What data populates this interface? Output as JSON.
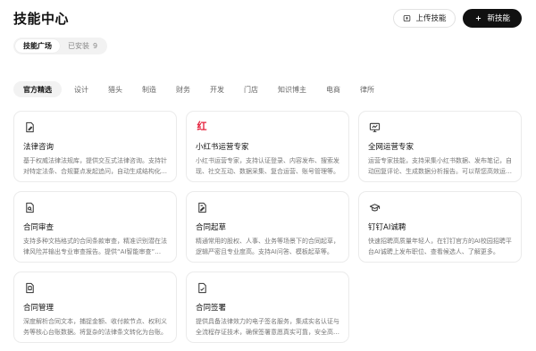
{
  "header": {
    "title": "技能中心",
    "upload_label": "上传技能",
    "new_label": "新技能"
  },
  "view_tabs": [
    {
      "label": "技能广场",
      "active": true
    },
    {
      "label": "已安装",
      "count": "9",
      "active": false
    }
  ],
  "categories": [
    "官方精选",
    "设计",
    "猎头",
    "制造",
    "财务",
    "开发",
    "门店",
    "知识博主",
    "电商",
    "律所"
  ],
  "active_category": "官方精选",
  "cards": [
    {
      "icon": "document-edit-icon",
      "title": "法律咨询",
      "desc": "基于权威法律法规库，提供交互式法律咨询。支持针对特定法条、合规要点发起追问，自动生成结构化法律意见。"
    },
    {
      "icon": "xiaohongshu-logo-icon",
      "icon_text": "红",
      "title": "小红书运营专家",
      "desc": "小红书运营专家，支持认证登录、内容发布、搜索发现、社交互动、数据采集、复合运营、账号管理等。"
    },
    {
      "icon": "monitor-icon",
      "title": "全网运营专家",
      "desc": "运营专家技能，支持采集小红书数据、发布笔记，自动回复评论、生成数据分析报告。可以帮您高效运营。"
    },
    {
      "icon": "document-search-icon",
      "title": "合同审查",
      "desc": "支持多种文档格式的合同条款审查，精准识别潜在法律风险并输出专业审查报告。提供“AI智能审查”能力。"
    },
    {
      "icon": "document-pen-icon",
      "title": "合同起草",
      "desc": "精通常用的股权、人事、业务等场景下的合同起草，逻辑严密且专业度高。支持AI问答、模板起草等。"
    },
    {
      "icon": "graduation-cap-icon",
      "title": "钉钉AI诚聘",
      "desc": "快速招聘高质量年轻人，在钉钉官方的AI校园招聘平台AI诚聘上发布职位、查看候选人、了解更多。"
    },
    {
      "icon": "document-folder-icon",
      "title": "合同管理",
      "desc": "深度解析合同文本，捕捉金额、收付款节点、权利义务等核心台账数据。将复杂的法律条文转化为台账。"
    },
    {
      "icon": "document-sign-icon",
      "title": "合同签署",
      "desc": "提供具备法律效力的电子签名服务，集成实名认证与全流程存证技术，确保签署意愿真实可靠，安全高效。"
    }
  ]
}
